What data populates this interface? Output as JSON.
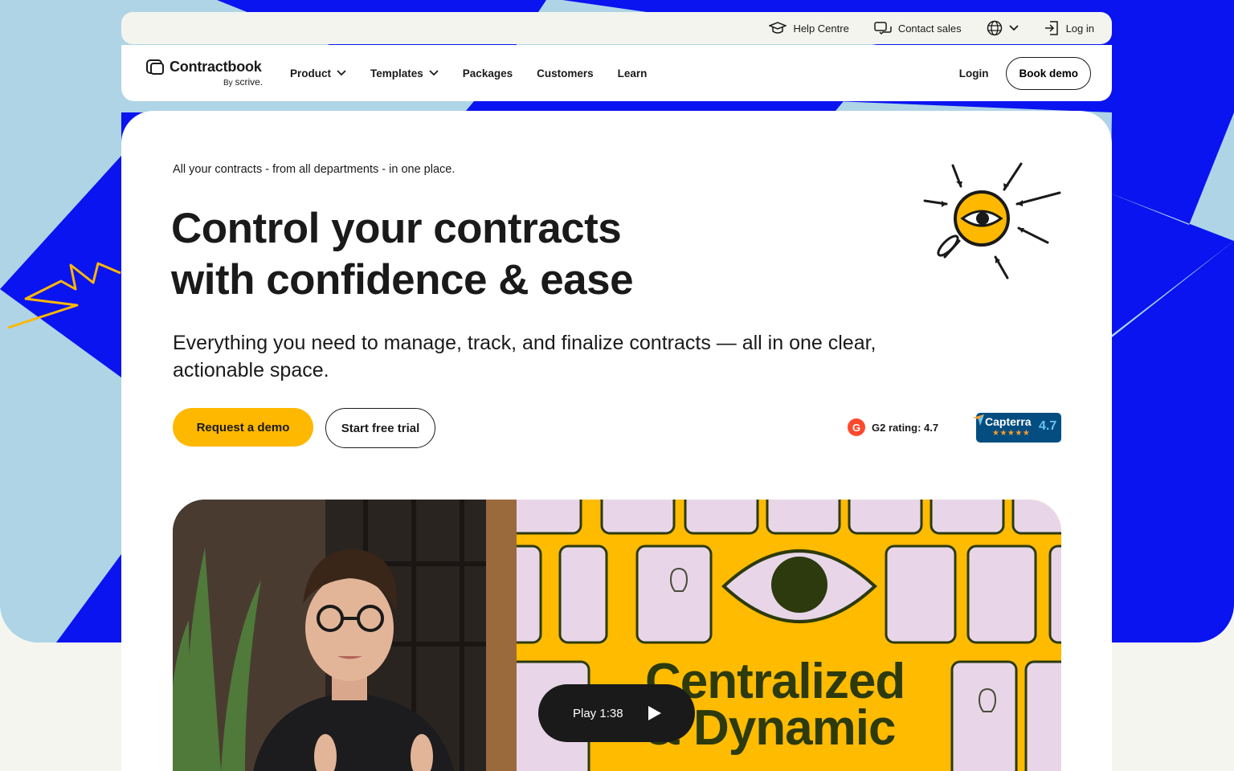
{
  "utility_bar": {
    "help_centre": "Help Centre",
    "contact_sales": "Contact sales",
    "log_in": "Log in"
  },
  "nav": {
    "logo_name": "Contractbook",
    "logo_by": "By",
    "logo_scrive": "scrive.",
    "items": [
      {
        "label": "Product",
        "has_dropdown": true
      },
      {
        "label": "Templates",
        "has_dropdown": true
      },
      {
        "label": "Packages",
        "has_dropdown": false
      },
      {
        "label": "Customers",
        "has_dropdown": false
      },
      {
        "label": "Learn",
        "has_dropdown": false
      }
    ],
    "login": "Login",
    "book_demo": "Book demo"
  },
  "hero": {
    "eyebrow": "All your contracts - from all departments - in one place.",
    "headline_line1": "Control your contracts",
    "headline_line2": "with confidence & ease",
    "subhead": "Everything you need to manage, track, and finalize contracts — all in one clear, actionable space.",
    "cta_primary": "Request a demo",
    "cta_secondary": "Start free trial",
    "g2_rating": "G2 rating: 4.7",
    "capterra_name": "Capterra",
    "capterra_score": "4.7"
  },
  "video": {
    "overlay_line1": "Centralized",
    "overlay_line2": "& Dynamic",
    "play_label": "Play 1:38"
  },
  "colors": {
    "accent_yellow": "#ffb800",
    "bg_blue": "#0a14f0",
    "bg_light_blue": "#aed4e6",
    "capterra_navy": "#044d80"
  }
}
